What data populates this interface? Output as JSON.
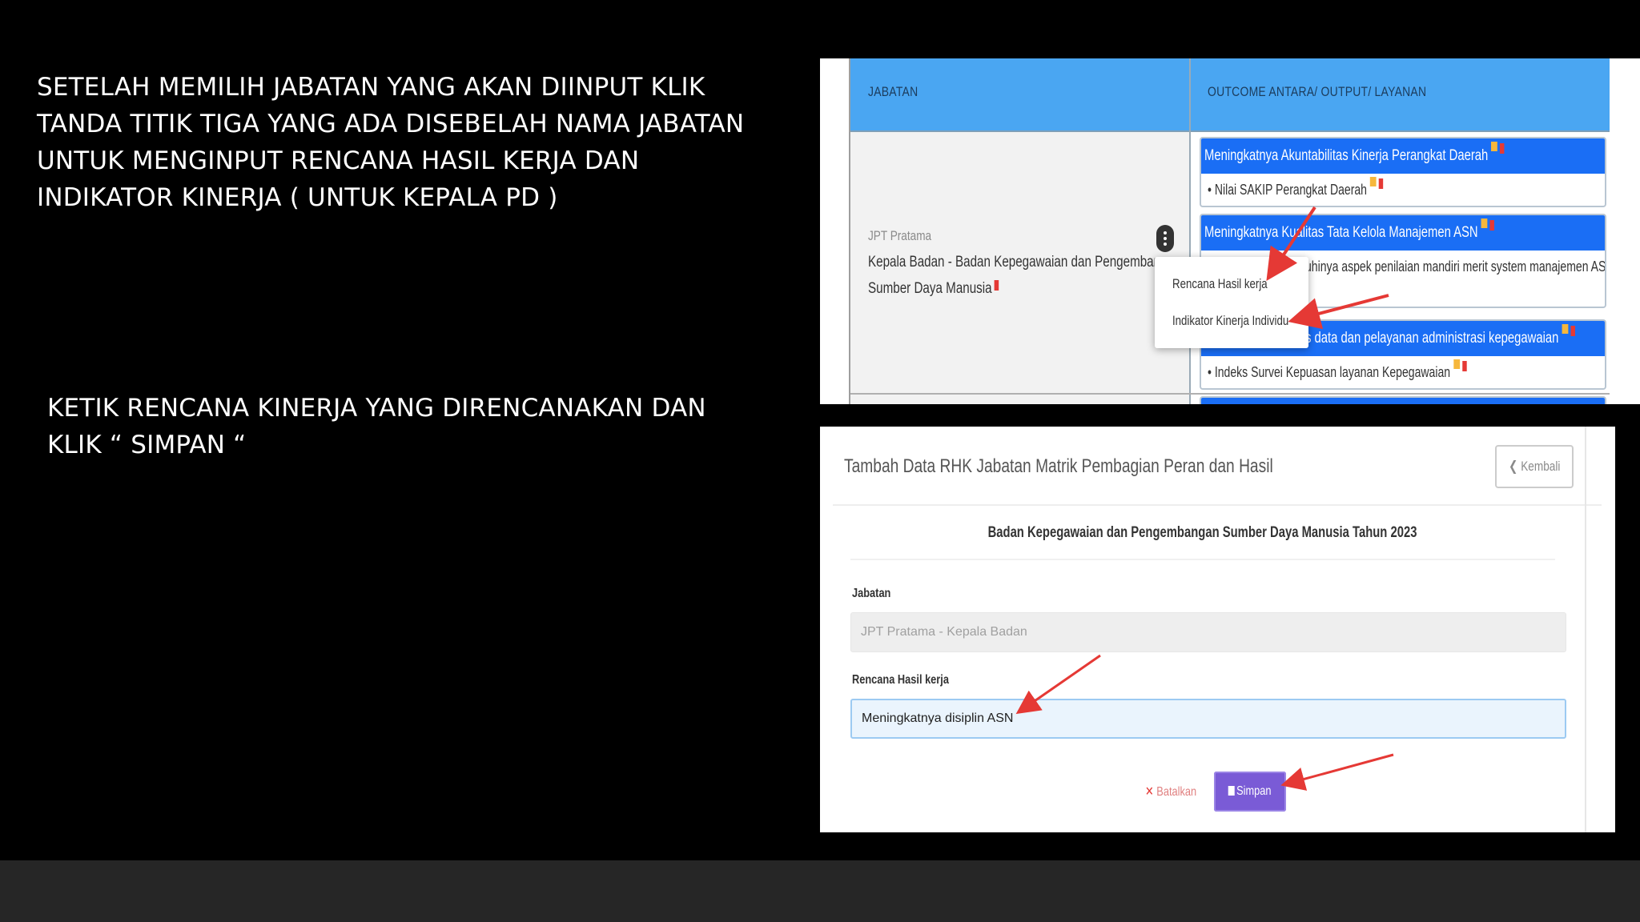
{
  "instructions": {
    "step1": "SETELAH MEMILIH JABATAN YANG AKAN DIINPUT KLIK TANDA TITIK TIGA YANG ADA DISEBELAH NAMA JABATAN UNTUK MENGINPUT RENCANA HASIL KERJA DAN INDIKATOR KINERJA ( UNTUK KEPALA PD )",
    "step2": "KETIK RENCANA KINERJA YANG DIRENCANAKAN DAN KLIK “ SIMPAN “"
  },
  "table": {
    "headers": [
      "JABATAN",
      "OUTCOME ANTARA/ OUTPUT/ LAYANAN"
    ],
    "row": {
      "level": "JPT Pratama",
      "jabatan": "Kepala Badan - Badan Kepegawaian dan Pengembangan Sumber Daya Manusia"
    },
    "outcomes": [
      {
        "title": "Meningkatnya Akuntabilitas Kinerja Perangkat Daerah",
        "indicator": "Nilai SAKIP Perangkat Daerah"
      },
      {
        "title": "Meningkatnya Kualitas Tata Kelola Manajemen ASN",
        "indicator": "uhinya aspek penilaian mandiri merit system manajemen ASN"
      },
      {
        "title": "s data dan pelayanan administrasi kepegawaian",
        "indicator": "Indeks Survei Kepuasan layanan Kepegawaian"
      }
    ],
    "context_menu": [
      "Rencana Hasil kerja",
      "Indikator Kinerja Individu"
    ]
  },
  "form": {
    "title": "Tambah Data RHK Jabatan Matrik Pembagian Peran dan Hasil",
    "back_label": "Kembali",
    "subtitle": "Badan Kepegawaian dan Pengembangan Sumber Daya Manusia Tahun 2023",
    "jabatan_label": "Jabatan",
    "jabatan_value": "JPT Pratama - Kepala Badan",
    "rhk_label": "Rencana Hasil kerja",
    "rhk_value": "Meningkatnya disiplin ASN",
    "cancel_label": "Batalkan",
    "save_label": "Simpan"
  },
  "colors": {
    "header_blue": "#4aa6f2",
    "card_blue": "#1a6ef5",
    "save_purple": "#7a5bd6",
    "arrow_red": "#e53935"
  }
}
